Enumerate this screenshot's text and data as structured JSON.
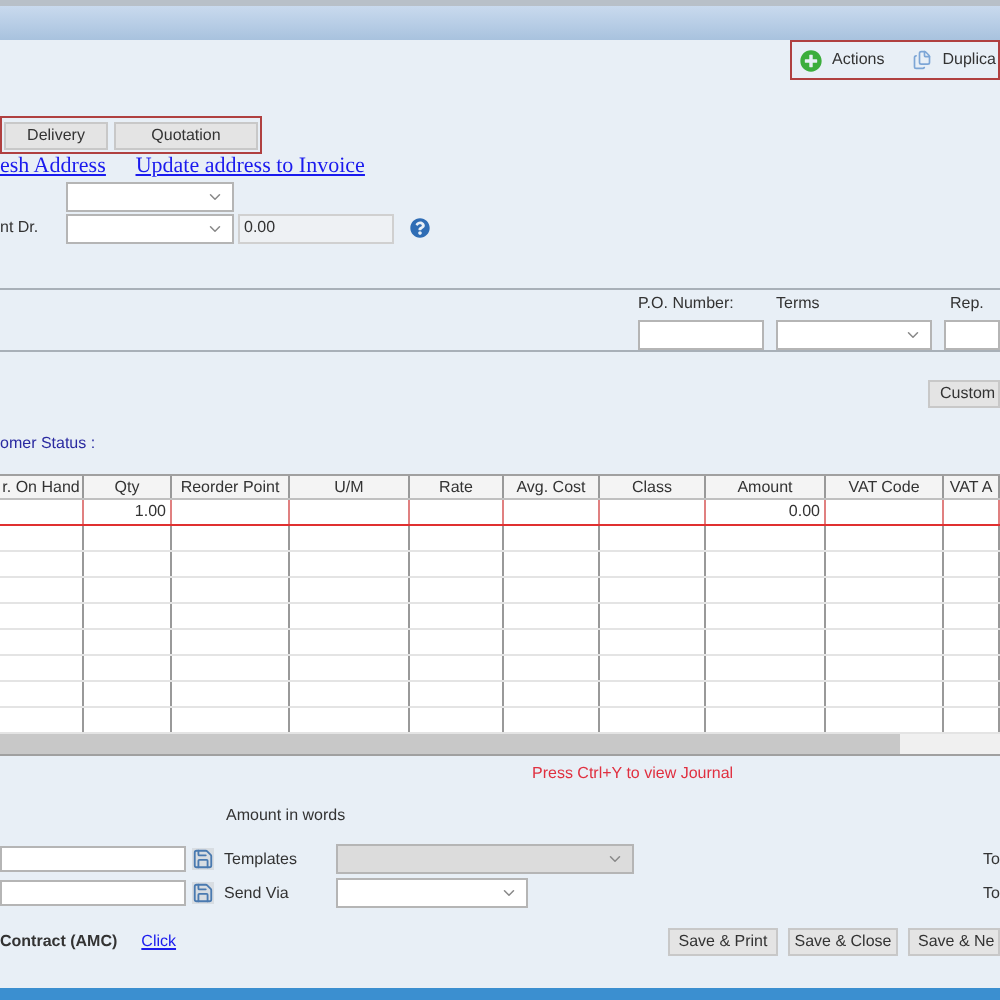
{
  "toolbar": [
    {
      "kind": "add",
      "label": "Actions"
    },
    {
      "kind": "copy",
      "label": "Duplica"
    }
  ],
  "tabs": [
    {
      "label": "Delivery",
      "selected": false
    },
    {
      "label": "Quotation",
      "selected": false
    }
  ],
  "links": [
    "esh Address",
    "Update address to Invoice"
  ],
  "account": {
    "label": "nt Dr.",
    "amount": "0.00"
  },
  "header_fields": {
    "po_label": "P.O. Number:",
    "terms_label": "Terms",
    "rep_label": "Rep."
  },
  "custom_button": "Custom",
  "status_label": "omer Status :",
  "grid": {
    "columns": [
      "r. On Hand",
      "Qty",
      "Reorder Point",
      "U/M",
      "Rate",
      "Avg. Cost",
      "Class",
      "Amount",
      "VAT Code",
      "VAT A"
    ],
    "rows": [
      {
        "selected": true,
        "qty": "1.00",
        "amount": "0.00"
      }
    ]
  },
  "journal_hint": "Press Ctrl+Y to view Journal",
  "amount_in_words_label": "Amount in words",
  "templates": {
    "label": "Templates",
    "disabled": true
  },
  "send_via": {
    "label": "Send Via"
  },
  "totals": [
    "To",
    "To"
  ],
  "amc": {
    "label": "Contract (AMC)",
    "link": "Click"
  },
  "buttons": [
    "Save & Print",
    "Save & Close",
    "Save & Ne"
  ]
}
